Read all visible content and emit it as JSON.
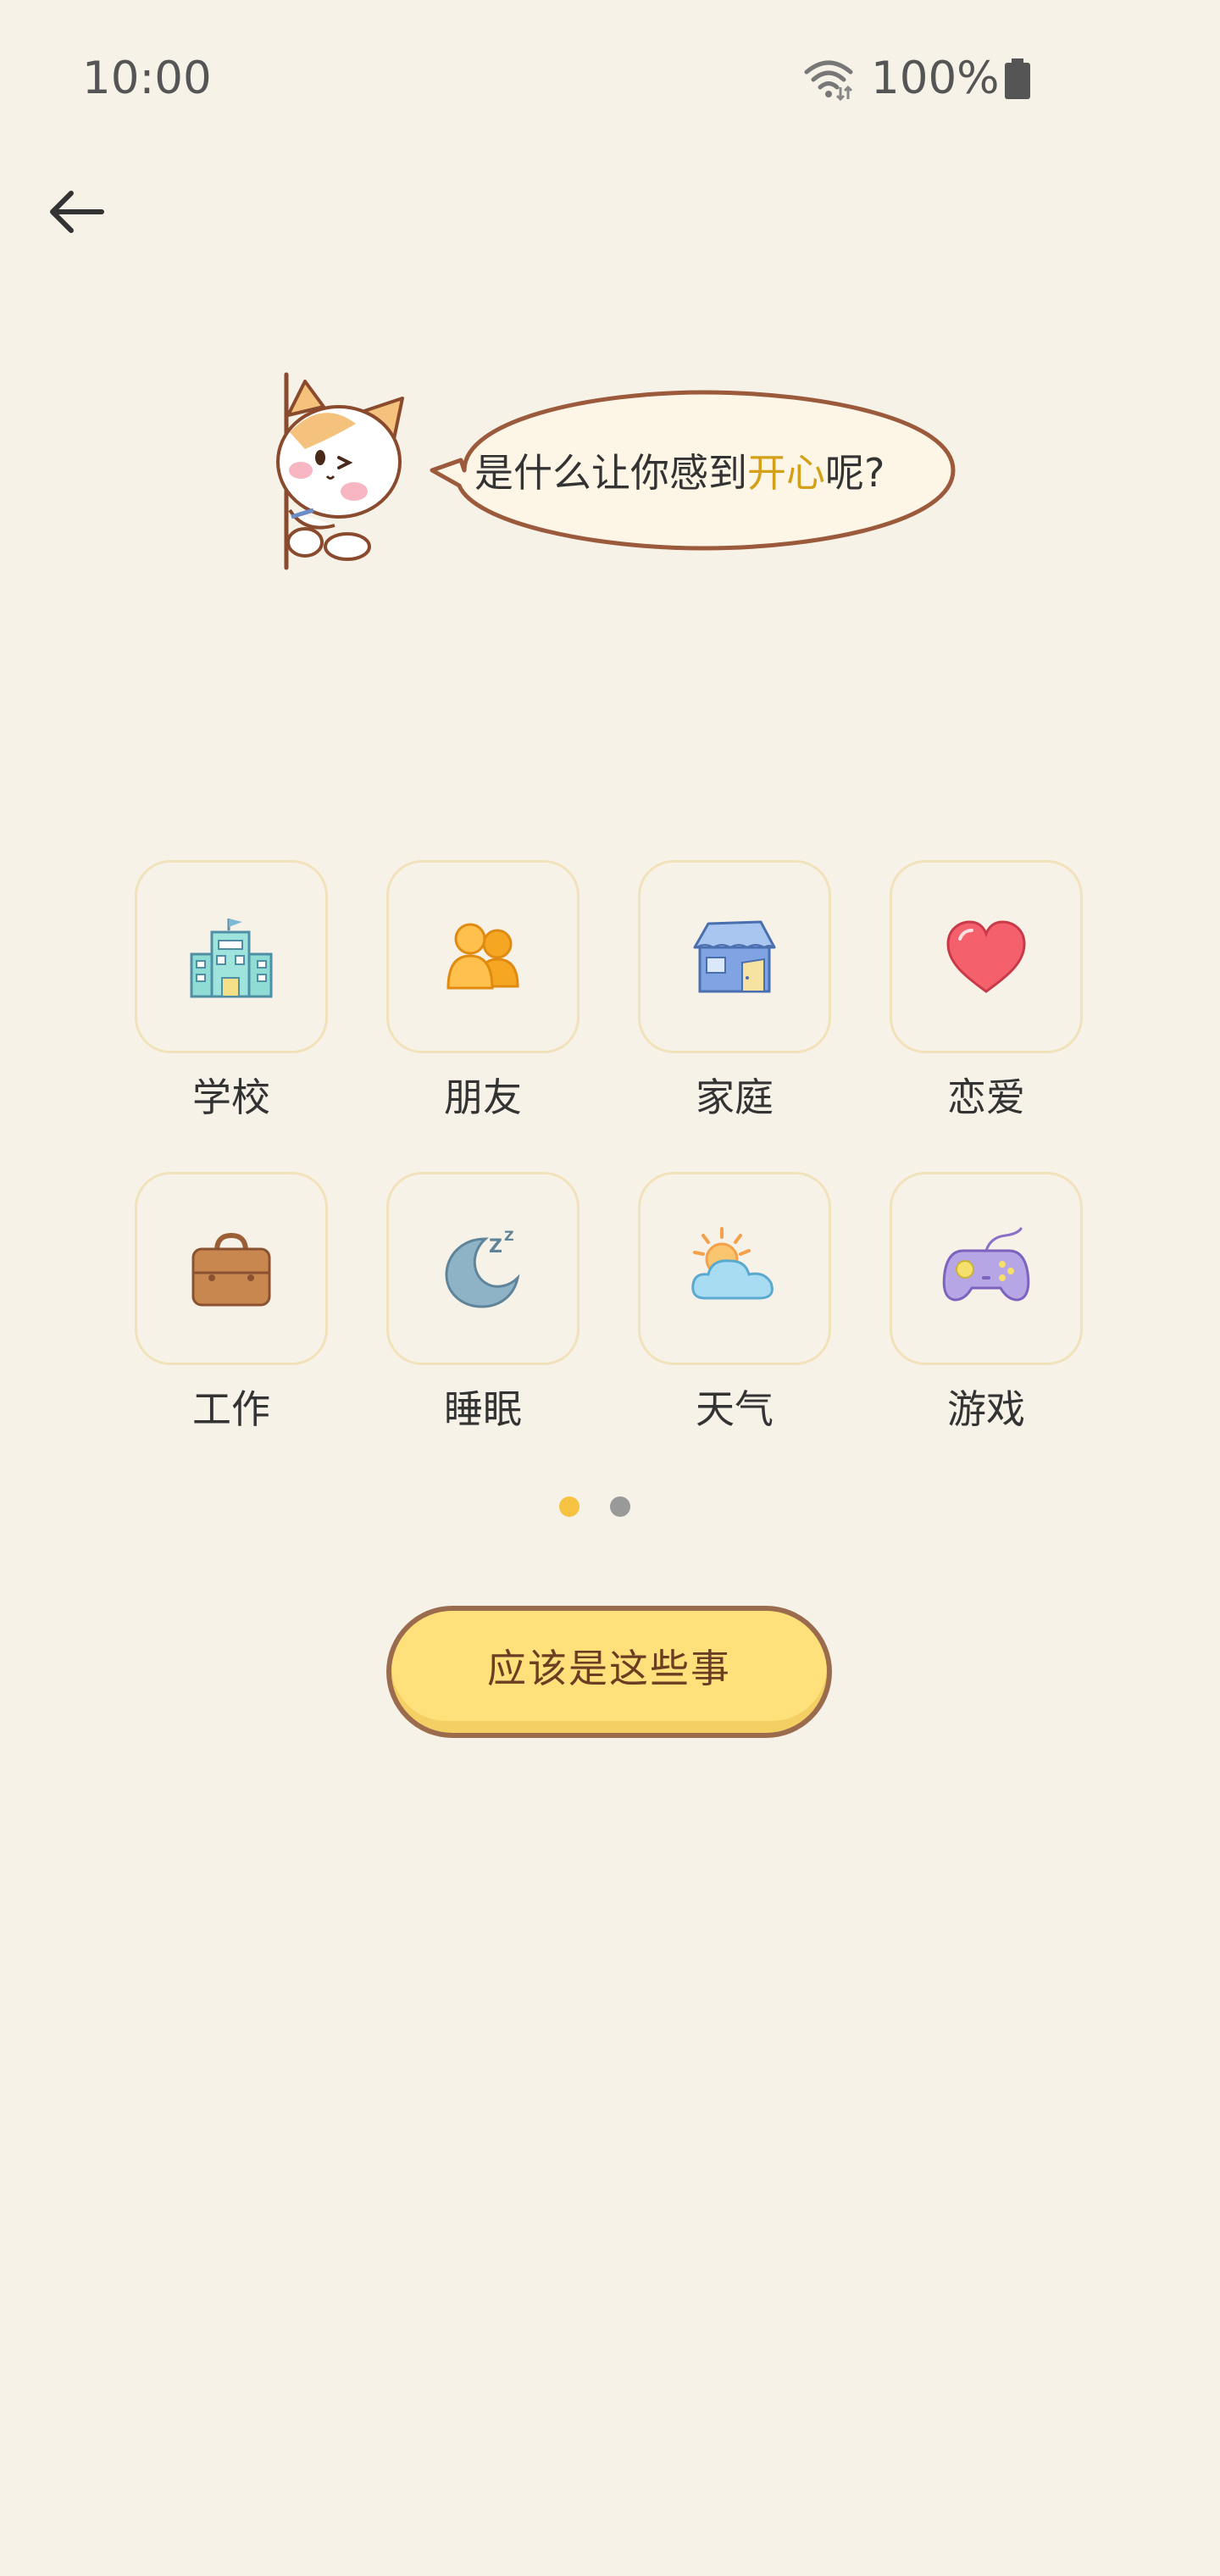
{
  "status_bar": {
    "time": "10:00",
    "battery": "100%"
  },
  "prompt": {
    "text_before": "是什么让你感到",
    "highlight": "开心",
    "text_after": "呢?",
    "highlight_color": "#d4a017"
  },
  "categories": [
    {
      "label": "学校",
      "icon": "school-icon"
    },
    {
      "label": "朋友",
      "icon": "friends-icon"
    },
    {
      "label": "家庭",
      "icon": "house-icon"
    },
    {
      "label": "恋爱",
      "icon": "heart-icon"
    },
    {
      "label": "工作",
      "icon": "briefcase-icon"
    },
    {
      "label": "睡眠",
      "icon": "moon-sleep-icon"
    },
    {
      "label": "天气",
      "icon": "sun-cloud-icon"
    },
    {
      "label": "游戏",
      "icon": "gamepad-icon"
    }
  ],
  "pagination": {
    "current": 1,
    "total": 2,
    "active_color": "#f5c242",
    "inactive_color": "#999999"
  },
  "primary_button": {
    "label": "应该是这些事"
  },
  "colors": {
    "background": "#f7f2e8",
    "tile_border": "#f2e2bb",
    "button_fill": "#ffe17c",
    "button_outline": "#9b6b4e"
  }
}
